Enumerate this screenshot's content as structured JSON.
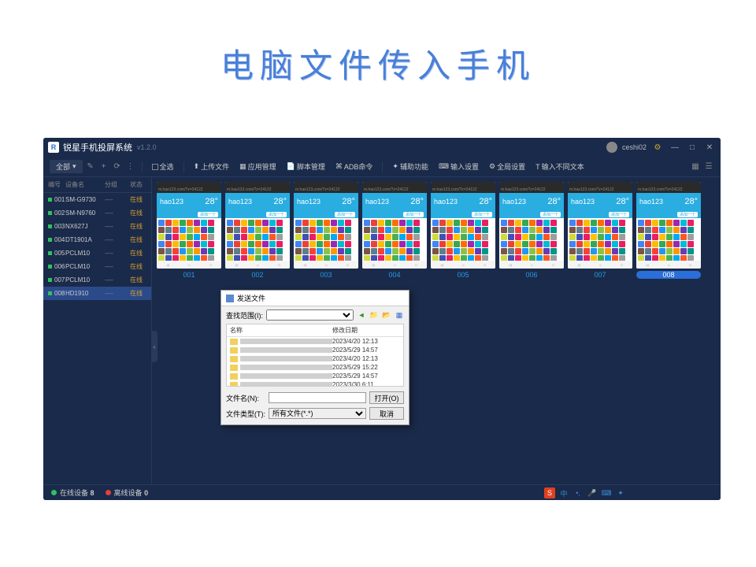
{
  "page": {
    "title": "电脑文件传入手机"
  },
  "app": {
    "name": "锐星手机投屏系统",
    "version": "v1.2.0",
    "user": "ceshi02"
  },
  "toolbar": {
    "filter": "全部",
    "selectAll": "全选",
    "buttons": [
      {
        "id": "upload",
        "label": "上传文件"
      },
      {
        "id": "appmgr",
        "label": "应用管理"
      },
      {
        "id": "script",
        "label": "脚本管理"
      },
      {
        "id": "adb",
        "label": "ADB命令"
      },
      {
        "id": "aux",
        "label": "辅助功能"
      },
      {
        "id": "input",
        "label": "输入设置"
      },
      {
        "id": "global",
        "label": "全局设置"
      },
      {
        "id": "text",
        "label": "输入不同文本"
      }
    ]
  },
  "deviceList": {
    "headers": {
      "id": "编号",
      "name": "设备名",
      "group": "分组",
      "status": "状态"
    },
    "rows": [
      {
        "id": "001",
        "name": "SM-G9730",
        "group": "----",
        "status": "在线"
      },
      {
        "id": "002",
        "name": "SM-N9760",
        "group": "----",
        "status": "在线"
      },
      {
        "id": "003",
        "name": "NX627J",
        "group": "----",
        "status": "在线"
      },
      {
        "id": "004",
        "name": "DT1901A",
        "group": "----",
        "status": "在线"
      },
      {
        "id": "005",
        "name": "PCLM10",
        "group": "----",
        "status": "在线"
      },
      {
        "id": "006",
        "name": "PCLM10",
        "group": "----",
        "status": "在线"
      },
      {
        "id": "007",
        "name": "PCLM10",
        "group": "----",
        "status": "在线"
      },
      {
        "id": "008",
        "name": "HD1910",
        "group": "----",
        "status": "在线"
      }
    ]
  },
  "thumbnails": {
    "phone": {
      "brand": "hao123",
      "temp": "28°",
      "url": "m.hao123.com/?z=24122",
      "action": "添加一个"
    },
    "labels": [
      "001",
      "002",
      "003",
      "004",
      "005",
      "006",
      "007",
      "008"
    ]
  },
  "statusbar": {
    "onlineLabel": "在线设备",
    "onlineCount": "8",
    "offlineLabel": "离线设备",
    "offlineCount": "0"
  },
  "fileDialog": {
    "title": "发送文件",
    "lookInLabel": "查找范围(I):",
    "headers": {
      "name": "名称",
      "date": "修改日期"
    },
    "files": [
      {
        "date": "2023/4/20 12:13"
      },
      {
        "date": "2023/5/29 14:57"
      },
      {
        "date": "2023/4/20 12:13"
      },
      {
        "date": "2023/5/29 15:22"
      },
      {
        "date": "2023/5/29 14:57"
      },
      {
        "date": "2023/3/30 6:11"
      }
    ],
    "fileNameLabel": "文件名(N):",
    "fileTypeLabel": "文件类型(T):",
    "fileTypeValue": "所有文件(*.*)",
    "openBtn": "打开(O)",
    "cancelBtn": "取消"
  },
  "ime": {
    "mode": "中"
  }
}
